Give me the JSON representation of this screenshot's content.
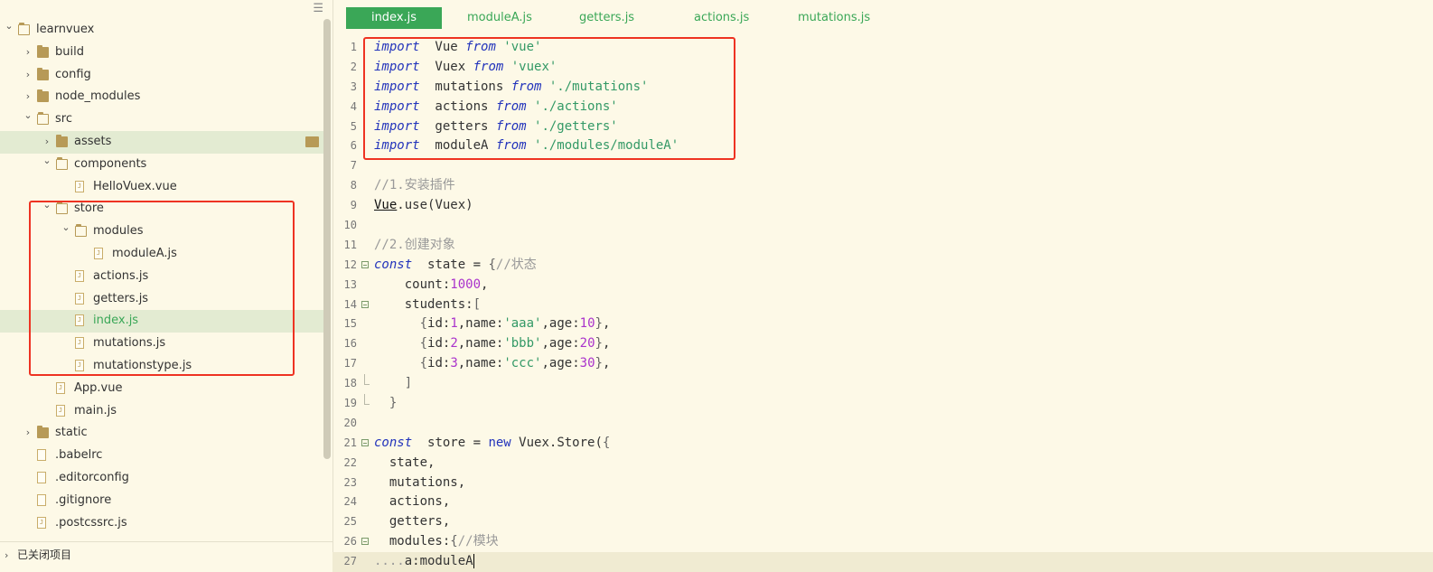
{
  "sidebar": {
    "root": "learnvuex",
    "items": [
      {
        "label": "learnvuex",
        "type": "folder-open",
        "depth": 0,
        "arrow": "open"
      },
      {
        "label": "build",
        "type": "folder",
        "depth": 1,
        "arrow": "closed"
      },
      {
        "label": "config",
        "type": "folder",
        "depth": 1,
        "arrow": "closed"
      },
      {
        "label": "node_modules",
        "type": "folder",
        "depth": 1,
        "arrow": "closed"
      },
      {
        "label": "src",
        "type": "folder-open",
        "depth": 1,
        "arrow": "open"
      },
      {
        "label": "assets",
        "type": "folder",
        "depth": 2,
        "arrow": "closed",
        "highlight": true
      },
      {
        "label": "components",
        "type": "folder-open",
        "depth": 2,
        "arrow": "open"
      },
      {
        "label": "HelloVuex.vue",
        "type": "file",
        "depth": 3,
        "arrow": "none"
      },
      {
        "label": "store",
        "type": "folder-open",
        "depth": 2,
        "arrow": "open"
      },
      {
        "label": "modules",
        "type": "folder-open",
        "depth": 3,
        "arrow": "open"
      },
      {
        "label": "moduleA.js",
        "type": "file",
        "depth": 4,
        "arrow": "none"
      },
      {
        "label": "actions.js",
        "type": "file",
        "depth": 3,
        "arrow": "none"
      },
      {
        "label": "getters.js",
        "type": "file",
        "depth": 3,
        "arrow": "none"
      },
      {
        "label": "index.js",
        "type": "file",
        "depth": 3,
        "arrow": "none",
        "highlight": true,
        "active": true
      },
      {
        "label": "mutations.js",
        "type": "file",
        "depth": 3,
        "arrow": "none"
      },
      {
        "label": "mutationstype.js",
        "type": "file",
        "depth": 3,
        "arrow": "none"
      },
      {
        "label": "App.vue",
        "type": "file",
        "depth": 2,
        "arrow": "none"
      },
      {
        "label": "main.js",
        "type": "file",
        "depth": 2,
        "arrow": "none"
      },
      {
        "label": "static",
        "type": "folder",
        "depth": 1,
        "arrow": "closed"
      },
      {
        "label": ".babelrc",
        "type": "file-plain",
        "depth": 1,
        "arrow": "none"
      },
      {
        "label": ".editorconfig",
        "type": "file-plain",
        "depth": 1,
        "arrow": "none"
      },
      {
        "label": ".gitignore",
        "type": "file-plain",
        "depth": 1,
        "arrow": "none"
      },
      {
        "label": ".postcssrc.js",
        "type": "file",
        "depth": 1,
        "arrow": "none"
      }
    ],
    "closed_section": "已关闭项目"
  },
  "tabs": [
    {
      "label": "index.js",
      "active": true
    },
    {
      "label": "moduleA.js"
    },
    {
      "label": "getters.js"
    },
    {
      "label": "actions.js"
    },
    {
      "label": "mutations.js"
    }
  ],
  "code": [
    {
      "n": "1",
      "t": [
        [
          "kw",
          "import"
        ],
        [
          "",
          "  Vue "
        ],
        [
          "kw",
          "from"
        ],
        [
          "str",
          " 'vue'"
        ]
      ]
    },
    {
      "n": "2",
      "t": [
        [
          "kw",
          "import"
        ],
        [
          "",
          "  Vuex "
        ],
        [
          "kw",
          "from"
        ],
        [
          "str",
          " 'vuex'"
        ]
      ]
    },
    {
      "n": "3",
      "t": [
        [
          "kw",
          "import"
        ],
        [
          "",
          "  mutations "
        ],
        [
          "kw",
          "from"
        ],
        [
          "str",
          " './mutations'"
        ]
      ]
    },
    {
      "n": "4",
      "t": [
        [
          "kw",
          "import"
        ],
        [
          "",
          "  actions "
        ],
        [
          "kw",
          "from"
        ],
        [
          "str",
          " './actions'"
        ]
      ]
    },
    {
      "n": "5",
      "t": [
        [
          "kw",
          "import"
        ],
        [
          "",
          "  getters "
        ],
        [
          "kw",
          "from"
        ],
        [
          "str",
          " './getters'"
        ]
      ]
    },
    {
      "n": "6",
      "t": [
        [
          "kw",
          "import"
        ],
        [
          "",
          "  moduleA "
        ],
        [
          "kw",
          "from"
        ],
        [
          "str",
          " './modules/moduleA'"
        ]
      ]
    },
    {
      "n": "7",
      "t": []
    },
    {
      "n": "8",
      "t": [
        [
          "cm",
          "//1.安装插件"
        ]
      ]
    },
    {
      "n": "9",
      "t": [
        [
          "vue-ul",
          "Vue"
        ],
        [
          "",
          ".use(Vuex)"
        ]
      ]
    },
    {
      "n": "10",
      "t": []
    },
    {
      "n": "11",
      "t": [
        [
          "cm",
          "//2.创建对象"
        ]
      ]
    },
    {
      "n": "12",
      "fold": true,
      "t": [
        [
          "kw",
          "const"
        ],
        [
          "",
          "  state = "
        ],
        [
          "br",
          "{"
        ],
        [
          "cm",
          "//状态"
        ]
      ]
    },
    {
      "n": "13",
      "t": [
        [
          "",
          "    count:"
        ],
        [
          "num",
          "1000"
        ],
        [
          "",
          ","
        ]
      ]
    },
    {
      "n": "14",
      "fold": true,
      "t": [
        [
          "",
          "    students:"
        ],
        [
          "br",
          "["
        ]
      ]
    },
    {
      "n": "15",
      "t": [
        [
          "",
          "      "
        ],
        [
          "br",
          "{"
        ],
        [
          "",
          "id:"
        ],
        [
          "num",
          "1"
        ],
        [
          "",
          ",name:"
        ],
        [
          "str",
          "'aaa'"
        ],
        [
          "",
          ",age:"
        ],
        [
          "num",
          "10"
        ],
        [
          "br",
          "}"
        ],
        [
          "",
          ","
        ]
      ]
    },
    {
      "n": "16",
      "t": [
        [
          "",
          "      "
        ],
        [
          "br",
          "{"
        ],
        [
          "",
          "id:"
        ],
        [
          "num",
          "2"
        ],
        [
          "",
          ",name:"
        ],
        [
          "str",
          "'bbb'"
        ],
        [
          "",
          ",age:"
        ],
        [
          "num",
          "20"
        ],
        [
          "br",
          "}"
        ],
        [
          "",
          ","
        ]
      ]
    },
    {
      "n": "17",
      "t": [
        [
          "",
          "      "
        ],
        [
          "br",
          "{"
        ],
        [
          "",
          "id:"
        ],
        [
          "num",
          "3"
        ],
        [
          "",
          ",name:"
        ],
        [
          "str",
          "'ccc'"
        ],
        [
          "",
          ",age:"
        ],
        [
          "num",
          "30"
        ],
        [
          "br",
          "}"
        ],
        [
          "",
          ","
        ]
      ]
    },
    {
      "n": "18",
      "foldend": true,
      "t": [
        [
          "",
          "    "
        ],
        [
          "br",
          "]"
        ]
      ]
    },
    {
      "n": "19",
      "foldend": true,
      "t": [
        [
          "",
          "  "
        ],
        [
          "br",
          "}"
        ]
      ]
    },
    {
      "n": "20",
      "t": []
    },
    {
      "n": "21",
      "fold": true,
      "t": [
        [
          "kw",
          "const"
        ],
        [
          "",
          "  store = "
        ],
        [
          "kw2",
          "new"
        ],
        [
          "",
          " Vuex.Store("
        ],
        [
          "br",
          "{"
        ]
      ]
    },
    {
      "n": "22",
      "t": [
        [
          "",
          "  state,"
        ]
      ]
    },
    {
      "n": "23",
      "t": [
        [
          "",
          "  mutations,"
        ]
      ]
    },
    {
      "n": "24",
      "t": [
        [
          "",
          "  actions,"
        ]
      ]
    },
    {
      "n": "25",
      "t": [
        [
          "",
          "  getters,"
        ]
      ]
    },
    {
      "n": "26",
      "fold": true,
      "t": [
        [
          "",
          "  modules:"
        ],
        [
          "br",
          "{"
        ],
        [
          "cm",
          "//模块"
        ]
      ]
    },
    {
      "n": "27",
      "current": true,
      "t": [
        [
          "cm",
          "...."
        ],
        [
          "",
          "a:moduleA"
        ]
      ]
    }
  ]
}
